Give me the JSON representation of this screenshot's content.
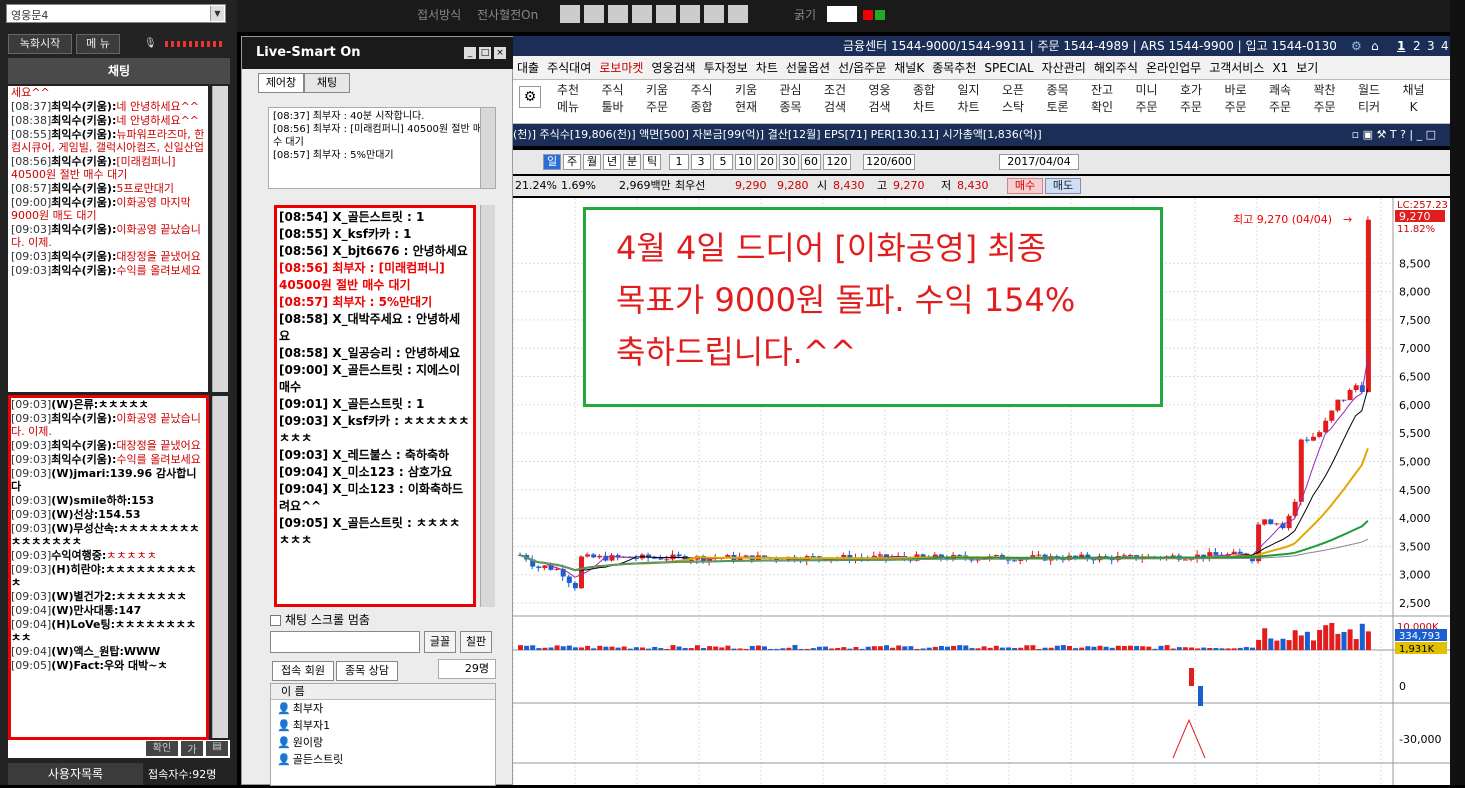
{
  "left": {
    "combo": "영웅문4",
    "rec_btn": "녹화시작",
    "menu_btn": "메 뉴",
    "chat_tab": "채팅",
    "chat1": [
      {
        "ts": "",
        "nm": "",
        "msg": "세요^^"
      },
      {
        "ts": "[08:37]",
        "nm": "최익수(키움):",
        "msg": "네 안녕하세요^^"
      },
      {
        "ts": "[08:38]",
        "nm": "최익수(키움):",
        "msg": "네 안녕하세요^^"
      },
      {
        "ts": "[08:55]",
        "nm": "최익수(키움):",
        "msg": "뉴파워프라즈마, 한컴시큐어, 게임빌, 갤럭시아컴즈, 신일산업"
      },
      {
        "ts": "[08:56]",
        "nm": "최익수(키움):",
        "msg": "[미래컴퍼니] 40500원 절반 매수 대기"
      },
      {
        "ts": "[08:57]",
        "nm": "최익수(키움):",
        "msg": "5프로만대기"
      },
      {
        "ts": "[09:00]",
        "nm": "최익수(키움):",
        "msg": "이화공영 마지막 9000원 매도 대기"
      },
      {
        "ts": "[09:03]",
        "nm": "최익수(키움):",
        "msg": "이화공영 끝났습니다. 이제."
      },
      {
        "ts": "[09:03]",
        "nm": "최익수(키움):",
        "msg": "대장정을 끝냈어요"
      },
      {
        "ts": "[09:03]",
        "nm": "최익수(키움):",
        "msg": "수익를 올려보세요"
      }
    ],
    "chat2": [
      {
        "ts": "[09:03]",
        "nm": "(W)은류:",
        "msg": "ㅊㅊㅊㅊㅊ",
        "bold": false
      },
      {
        "ts": "[09:03]",
        "nm": "최익수(키움):",
        "msg": "이화공영 끝났습니다. 이제.",
        "bold": true
      },
      {
        "ts": "[09:03]",
        "nm": "최익수(키움):",
        "msg": "대장정을 끝냈어요",
        "bold": true
      },
      {
        "ts": "[09:03]",
        "nm": "최익수(키움):",
        "msg": "수익를 올려보세요",
        "bold": true
      },
      {
        "ts": "[09:03]",
        "nm": "(W)jmari:",
        "msg": "139.96 감사합니다",
        "bold": false
      },
      {
        "ts": "[09:03]",
        "nm": "(W)smile하하:",
        "msg": "153",
        "bold": false
      },
      {
        "ts": "[09:03]",
        "nm": "(W)선상:",
        "msg": "154.53",
        "bold": false
      },
      {
        "ts": "[09:03]",
        "nm": "(W)무성산속:",
        "msg": "ㅊㅊㅊㅊㅊㅊㅊㅊㅊㅊㅊㅊㅊㅊㅊ",
        "bold": false
      },
      {
        "ts": "[09:03]",
        "nm": "수익여행중:",
        "msg": "ㅊㅊㅊㅊㅊ",
        "bold": true
      },
      {
        "ts": "[09:03]",
        "nm": "(H)히란야:",
        "msg": "ㅊㅊㅊㅊㅊㅊㅊㅊㅊㅊ",
        "bold": false
      },
      {
        "ts": "[09:03]",
        "nm": "(W)별건가2:",
        "msg": "ㅊㅊㅊㅊㅊㅊㅊ",
        "bold": false
      },
      {
        "ts": "[09:04]",
        "nm": "(W)만사대통:",
        "msg": "147",
        "bold": false
      },
      {
        "ts": "[09:04]",
        "nm": "(H)LoVe팅:",
        "msg": "ㅊㅊㅊㅊㅊㅊㅊㅊㅊㅊ",
        "bold": false
      },
      {
        "ts": "[09:04]",
        "nm": "(W)액스_원탑:",
        "msg": "WWW",
        "bold": false
      },
      {
        "ts": "[09:05]",
        "nm": "(W)Fact:",
        "msg": "우와 대박~ㅊ",
        "bold": false
      }
    ],
    "confirm": "확인",
    "userlist": "사용자목록",
    "conn_label": "접속자수",
    "conn_count": "92명"
  },
  "mid": {
    "title": "Live-Smart On",
    "tab1": "제어창",
    "tab2": "채팅",
    "top_chat": [
      "[08:37] 최부자 : 40분 시작합니다.",
      "[08:56] 최부자 : [미래컴퍼니] 40500원 절반 매수 대기",
      "[08:57] 최부자 : 5%만대기"
    ],
    "main_chat": [
      {
        "t": "[08:54] X_골든스트릿 : 1",
        "red": false
      },
      {
        "t": "[08:55] X_ksf카카 : 1",
        "red": false
      },
      {
        "t": "[08:56] X_bjt6676 : 안녕하세요",
        "red": false
      },
      {
        "t": "[08:56] 최부자 : [미래컴퍼니] 40500원 절반 매수 대기",
        "red": true
      },
      {
        "t": "[08:57] 최부자 : 5%만대기",
        "red": true
      },
      {
        "t": "[08:58] X_대박주세요 : 안녕하세요",
        "red": false
      },
      {
        "t": "[08:58] X_일공승리 : 안녕하세요",
        "red": false
      },
      {
        "t": "[09:00] X_골든스트릿 : 지에스이 매수",
        "red": false
      },
      {
        "t": "[09:01] X_골든스트릿 : 1",
        "red": false
      },
      {
        "t": "[09:03] X_ksf카카 : ㅊㅊㅊㅊㅊㅊㅊㅊㅊ",
        "red": false
      },
      {
        "t": "[09:03] X_레드불스 : 축하축하",
        "red": false
      },
      {
        "t": "[09:04] X_미소123 : 삼호가요",
        "red": false
      },
      {
        "t": "[09:04] X_미소123 : 이화축하드려요^^",
        "red": false
      },
      {
        "t": "[09:05] X_골든스트릿 : ㅊㅊㅊㅊㅊㅊㅊ",
        "red": false
      }
    ],
    "scroll_lock": "채팅 스크롤 멈춤",
    "font_btn": "글꼴",
    "board_btn": "칠판",
    "tab_members": "접속 회원",
    "tab_stock": "종목 상담",
    "count": "29명",
    "list_head": "이 름",
    "members": [
      "최부자",
      "최부자1",
      "원이랑",
      "골든스트릿"
    ]
  },
  "top": {
    "info": "금융센터 1544-9000/1544-9911 | 주문 1544-4989 | ARS 1544-9900 | 입고 1544-0130",
    "pages": [
      "1",
      "2",
      "3",
      "4"
    ],
    "toolbar_labels": [
      "접서방식",
      "전사혈전On",
      "굵기"
    ],
    "menus": [
      "대출",
      "주식대여",
      "로보마켓",
      "영웅검색",
      "투자정보",
      "차트",
      "선물옵션",
      "선/옵주문",
      "채널K",
      "종목추천",
      "SPECIAL",
      "자산관리",
      "해외주식",
      "온라인업무",
      "고객서비스",
      "X1",
      "보기"
    ],
    "icons": [
      [
        "추천",
        "메뉴"
      ],
      [
        "주식",
        "툴바"
      ],
      [
        "키움",
        "주문"
      ],
      [
        "주식",
        "종합"
      ],
      [
        "키움",
        "현재"
      ],
      [
        "관심",
        "종목"
      ],
      [
        "조건",
        "검색"
      ],
      [
        "영웅",
        "검색"
      ],
      [
        "종합",
        "차트"
      ],
      [
        "일지",
        "차트"
      ],
      [
        "오픈",
        "스탁"
      ],
      [
        "종목",
        "토론"
      ],
      [
        "잔고",
        "확인"
      ],
      [
        "미니",
        "주문"
      ],
      [
        "호가",
        "주문"
      ],
      [
        "바로",
        "주문"
      ],
      [
        "쾌속",
        "주문"
      ],
      [
        "꽉찬",
        "주문"
      ],
      [
        "월드",
        "티커"
      ],
      [
        "채널",
        "K"
      ]
    ],
    "stockinfo": "(천)] 주식수[19,806(천)] 액면[500] 자본금[99(억)] 결산[12월] EPS[71] PER[130.11] 시가총액[1,836(억)]",
    "periods": [
      "일",
      "주",
      "월",
      "년",
      "분",
      "틱",
      "1",
      "3",
      "5",
      "10",
      "20",
      "30",
      "60",
      "120"
    ],
    "range": "120/600",
    "date": "2017/04/04",
    "pricebar": {
      "pct": "21.24%",
      "pct2": "1.69%",
      "amount": "2,969백만",
      "prior_label": "최우선",
      "p1": "9,290",
      "p2": "9,280",
      "open_label": "시",
      "open": "8,430",
      "high_label": "고",
      "high": "9,270",
      "low_label": "저",
      "low": "8,430",
      "buy": "매수",
      "sell": "매도"
    }
  },
  "chart": {
    "annotation_lines": [
      "4월 4일 드디어 [이화공영] 최종",
      "목표가 9000원 돌파. 수익 154%",
      "축하드립니다.^^"
    ],
    "high_label": "최고 9,270 (04/04)",
    "yticks": [
      "8,500",
      "8,000",
      "7,500",
      "7,000",
      "6,500",
      "6,000",
      "5,500",
      "5,000",
      "4,500",
      "4,000",
      "3,500",
      "3,000",
      "2,500"
    ],
    "right_price": "9,270",
    "right_pct": "11.82%",
    "right_top": "LC:257.23",
    "vol_label1": "334,793",
    "vol_label2": "1,931K",
    "vol_tick": "10,000K",
    "ind_tick1": "0",
    "ind_tick2": "-30,000",
    "colors": {
      "up": "#e21d1d",
      "down": "#1a5fd1",
      "ma5": "#9b28b4",
      "ma10": "#000000",
      "ma20": "#e0a800",
      "ma60": "#1e9a3a",
      "ma120": "#888888"
    }
  }
}
